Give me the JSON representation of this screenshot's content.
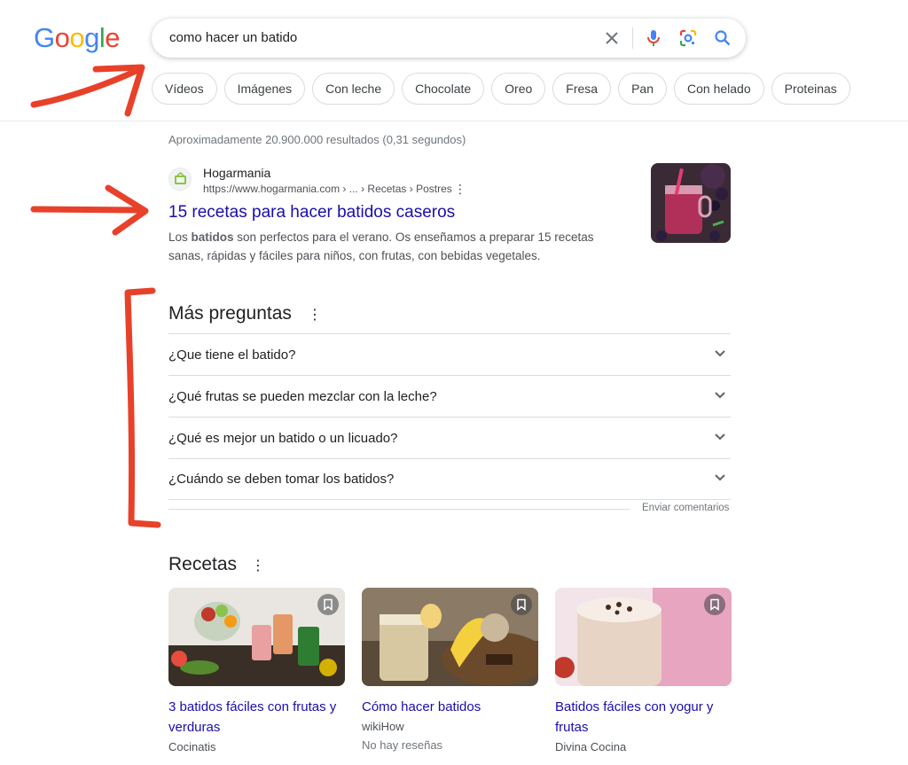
{
  "logo": {
    "letters": [
      "G",
      "o",
      "o",
      "g",
      "l",
      "e"
    ],
    "colors": [
      "#4285f4",
      "#ea4335",
      "#fbbc05",
      "#4285f4",
      "#34a853",
      "#ea4335"
    ]
  },
  "search": {
    "query": "como hacer un batido"
  },
  "chips": [
    "Vídeos",
    "Imágenes",
    "Con leche",
    "Chocolate",
    "Oreo",
    "Fresa",
    "Pan",
    "Con helado",
    "Proteinas"
  ],
  "stats": "Aproximadamente 20.900.000 resultados (0,31 segundos)",
  "result": {
    "site": "Hogarmania",
    "url": "https://www.hogarmania.com › ... › Recetas › Postres",
    "title": "15 recetas para hacer batidos caseros",
    "snippet_pre": "Los ",
    "snippet_bold": "batidos",
    "snippet_post": " son perfectos para el verano. Os enseñamos a preparar 15 recetas sanas, rápidas y fáciles para niños, con frutas, con bebidas vegetales."
  },
  "paa": {
    "title": "Más preguntas",
    "questions": [
      "¿Que tiene el batido?",
      "¿Qué frutas se pueden mezclar con la leche?",
      "¿Qué es mejor un batido o un licuado?",
      "¿Cuándo se deben tomar los batidos?"
    ],
    "feedback": "Enviar comentarios"
  },
  "recipes": {
    "title": "Recetas",
    "items": [
      {
        "title": "3 batidos fáciles con frutas y verduras",
        "source": "Cocinatis",
        "reviews": ""
      },
      {
        "title": "Cómo hacer batidos",
        "source": "wikiHow",
        "reviews": "No hay reseñas"
      },
      {
        "title": "Batidos fáciles con yogur y frutas",
        "source": "Divina Cocina",
        "reviews": ""
      }
    ]
  },
  "colors": {
    "link": "#1a0dab",
    "annotation": "#e8412a"
  }
}
